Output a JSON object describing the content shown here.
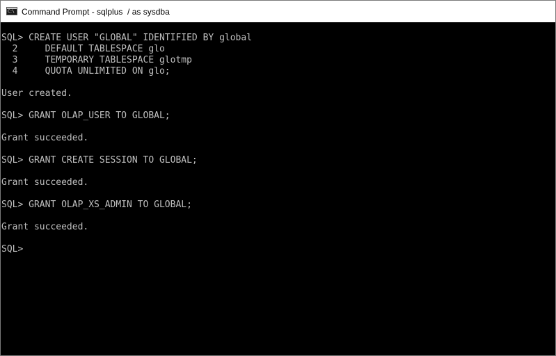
{
  "window": {
    "title": "Command Prompt - sqlplus  / as sysdba",
    "icon": "cmd-icon"
  },
  "console": {
    "lines": [
      "SQL> CREATE USER \"GLOBAL\" IDENTIFIED BY global",
      "  2     DEFAULT TABLESPACE glo",
      "  3     TEMPORARY TABLESPACE glotmp",
      "  4     QUOTA UNLIMITED ON glo;",
      "",
      "User created.",
      "",
      "SQL> GRANT OLAP_USER TO GLOBAL;",
      "",
      "Grant succeeded.",
      "",
      "SQL> GRANT CREATE SESSION TO GLOBAL;",
      "",
      "Grant succeeded.",
      "",
      "SQL> GRANT OLAP_XS_ADMIN TO GLOBAL;",
      "",
      "Grant succeeded.",
      "",
      "SQL>"
    ],
    "text_color": "#c0c0c0",
    "background": "#000000"
  }
}
